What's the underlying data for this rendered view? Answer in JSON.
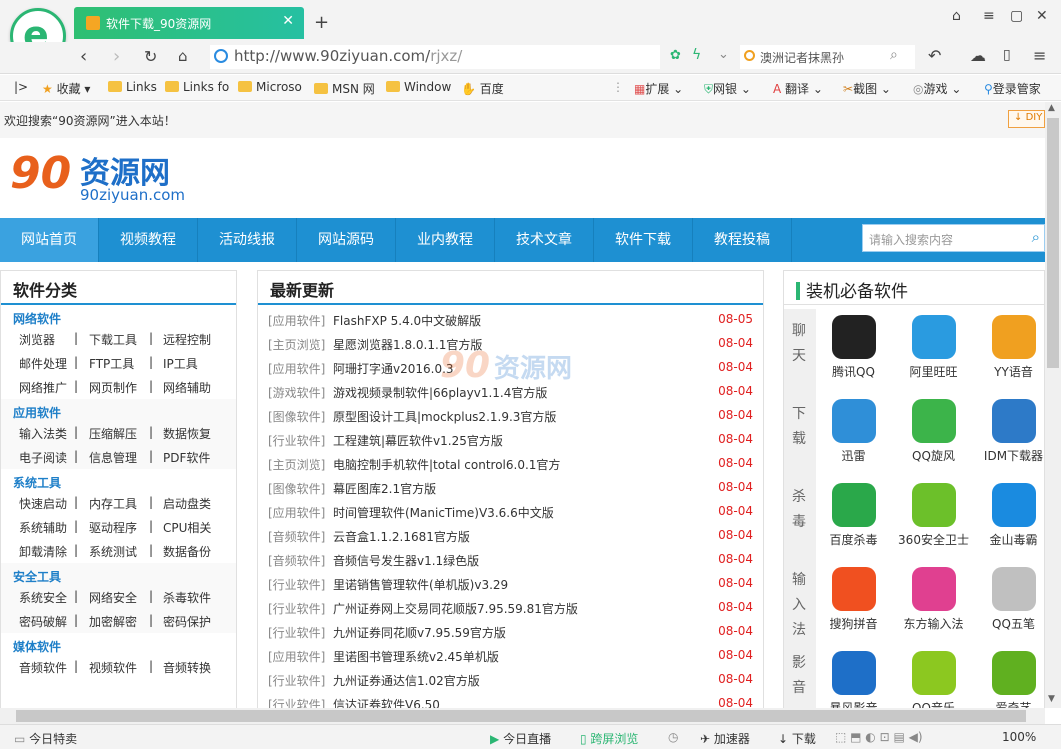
{
  "tab": {
    "title": "软件下载_90资源网"
  },
  "address": {
    "url_main": "http://www.90ziyuan.com/",
    "url_path": "rjxz/"
  },
  "search": {
    "text": "澳洲记者抹黑孙"
  },
  "bookmarks": {
    "items": [
      "收藏",
      "Links",
      "Links fo",
      "Microso",
      "MSN 网",
      "Window",
      "百度"
    ],
    "tools": [
      "扩展",
      "网银",
      "翻译",
      "截图",
      "游戏",
      "登录管家"
    ]
  },
  "page": {
    "welcome": "欢迎搜索“90资源网”进入本站！",
    "diy": "DIY",
    "logo_cn": "资源网",
    "logo_num": "90",
    "logo_en": "90ziyuan.com"
  },
  "nav": {
    "items": [
      "网站首页",
      "视频教程",
      "活动线报",
      "网站源码",
      "业内教程",
      "技术文章",
      "软件下载",
      "教程投稿"
    ],
    "search_placeholder": "请输入搜索内容"
  },
  "left": {
    "title": "软件分类",
    "groups": [
      {
        "name": "网络软件",
        "rows": [
          [
            "浏览器",
            "下载工具",
            "远程控制"
          ],
          [
            "邮件处理",
            "FTP工具",
            "IP工具"
          ],
          [
            "网络推广",
            "网页制作",
            "网络辅助"
          ]
        ]
      },
      {
        "name": "应用软件",
        "rows": [
          [
            "输入法类",
            "压缩解压",
            "数据恢复"
          ],
          [
            "电子阅读",
            "信息管理",
            "PDF软件"
          ]
        ]
      },
      {
        "name": "系统工具",
        "rows": [
          [
            "快速启动",
            "内存工具",
            "启动盘类"
          ],
          [
            "系统辅助",
            "驱动程序",
            "CPU相关"
          ],
          [
            "卸载清除",
            "系统测试",
            "数据备份"
          ]
        ]
      },
      {
        "name": "安全工具",
        "rows": [
          [
            "系统安全",
            "网络安全",
            "杀毒软件"
          ],
          [
            "密码破解",
            "加密解密",
            "密码保护"
          ]
        ]
      },
      {
        "name": "媒体软件",
        "rows": [
          [
            "音频软件",
            "视频软件",
            "音频转换"
          ]
        ]
      }
    ]
  },
  "center": {
    "title": "最新更新",
    "rows": [
      {
        "cat": "[应用软件]",
        "title": "FlashFXP 5.4.0中文破解版",
        "date": "08-05"
      },
      {
        "cat": "[主页浏览]",
        "title": "星愿浏览器1.8.0.1.1官方版",
        "date": "08-04"
      },
      {
        "cat": "[应用软件]",
        "title": "阿珊打字通v2016.0.3",
        "date": "08-04"
      },
      {
        "cat": "[游戏软件]",
        "title": "游戏视频录制软件|66playv1.1.4官方版",
        "date": "08-04"
      },
      {
        "cat": "[图像软件]",
        "title": "原型图设计工具|mockplus2.1.9.3官方版",
        "date": "08-04"
      },
      {
        "cat": "[行业软件]",
        "title": "工程建筑|幕匠软件v1.25官方版",
        "date": "08-04"
      },
      {
        "cat": "[主页浏览]",
        "title": "电脑控制手机软件|total control6.0.1官方",
        "date": "08-04"
      },
      {
        "cat": "[图像软件]",
        "title": "幕匠图库2.1官方版",
        "date": "08-04"
      },
      {
        "cat": "[应用软件]",
        "title": "时间管理软件(ManicTime)V3.6.6中文版",
        "date": "08-04"
      },
      {
        "cat": "[音频软件]",
        "title": "云音盒1.1.2.1681官方版",
        "date": "08-04"
      },
      {
        "cat": "[音频软件]",
        "title": "音频信号发生器v1.1绿色版",
        "date": "08-04"
      },
      {
        "cat": "[行业软件]",
        "title": "里诺销售管理软件(单机版)v3.29",
        "date": "08-04"
      },
      {
        "cat": "[行业软件]",
        "title": "广州证券网上交易同花顺版7.95.59.81官方版",
        "date": "08-04"
      },
      {
        "cat": "[行业软件]",
        "title": "九州证券同花顺v7.95.59官方版",
        "date": "08-04"
      },
      {
        "cat": "[应用软件]",
        "title": "里诺图书管理系统v2.45单机版",
        "date": "08-04"
      },
      {
        "cat": "[行业软件]",
        "title": "九州证券通达信1.02官方版",
        "date": "08-04"
      },
      {
        "cat": "[行业软件]",
        "title": "信达证券软件V6.50",
        "date": "08-04"
      }
    ]
  },
  "right": {
    "title": "装机必备软件",
    "side_tabs": [
      "聊天",
      "下载",
      "杀毒",
      "输入法",
      "影音"
    ],
    "apps": [
      {
        "name": "腾讯QQ",
        "color": "#222222"
      },
      {
        "name": "阿里旺旺",
        "color": "#2a9be0"
      },
      {
        "name": "YY语音",
        "color": "#f0a020"
      },
      {
        "name": "迅雷",
        "color": "#2f8fd8"
      },
      {
        "name": "QQ旋风",
        "color": "#3cb44a"
      },
      {
        "name": "IDM下载器",
        "color": "#2d7ac8"
      },
      {
        "name": "百度杀毒",
        "color": "#2aa84a"
      },
      {
        "name": "360安全卫士",
        "color": "#6cc02a"
      },
      {
        "name": "金山毒霸",
        "color": "#1a8be0"
      },
      {
        "name": "搜狗拼音",
        "color": "#f05020"
      },
      {
        "name": "东方输入法",
        "color": "#e04090"
      },
      {
        "name": "QQ五笔",
        "color": "#c0c0c0"
      },
      {
        "name": "暴风影音",
        "color": "#1e6fc8"
      },
      {
        "name": "QQ音乐",
        "color": "#8cc820"
      },
      {
        "name": "爱奇艺",
        "color": "#60b020"
      }
    ]
  },
  "status": {
    "left": "今日特卖",
    "items": [
      "今日直播",
      "跨屏浏览",
      "加速器",
      "下载"
    ],
    "zoom": "100%"
  },
  "colors": {
    "brand_blue": "#1e90d2",
    "date_red": "#e02020",
    "tab_green": "#2fbf72"
  }
}
